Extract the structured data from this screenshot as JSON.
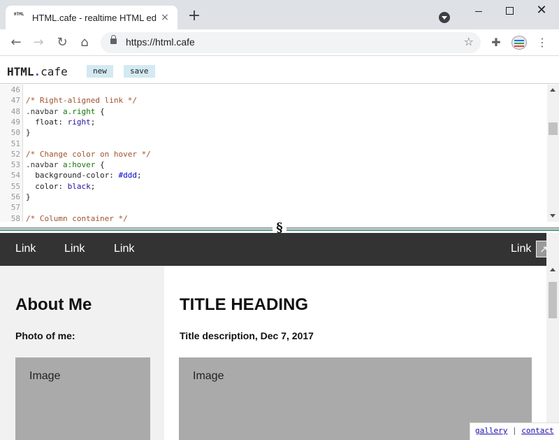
{
  "browser": {
    "tab_title": "HTML.cafe - realtime HTML editor",
    "favicon_text": "HTML",
    "tab_close": "×",
    "new_tab": "+",
    "url": "https://html.cafe",
    "icons": {
      "back": "back-arrow-icon",
      "forward": "forward-arrow-icon",
      "reload": "reload-icon",
      "home": "home-icon",
      "star": "star-icon",
      "extensions": "puzzle-icon",
      "menu": "kebab-menu-icon"
    },
    "glyphs": {
      "back": "←",
      "forward": "→",
      "reload": "↻",
      "home": "⌂",
      "star": "☆",
      "extensions": "✚",
      "menu": "⋮",
      "close": "✕"
    }
  },
  "app": {
    "logo_main": "HTML",
    "logo_dot": ".",
    "logo_suffix": "cafe",
    "buttons": {
      "new": "new",
      "save": "save"
    },
    "splitter_glyph": "§",
    "accent_color": "#7b3fbf"
  },
  "editor": {
    "lines": [
      {
        "num": "46",
        "text": ""
      },
      {
        "num": "47",
        "text": "/* Right-aligned link */"
      },
      {
        "num": "48",
        "text": ".navbar a.right {"
      },
      {
        "num": "49",
        "text": "  float: right;"
      },
      {
        "num": "50",
        "text": "}"
      },
      {
        "num": "51",
        "text": ""
      },
      {
        "num": "52",
        "text": "/* Change color on hover */"
      },
      {
        "num": "53",
        "text": ".navbar a:hover {"
      },
      {
        "num": "54",
        "text": "  background-color: #ddd;"
      },
      {
        "num": "55",
        "text": "  color: black;"
      },
      {
        "num": "56",
        "text": "}"
      },
      {
        "num": "57",
        "text": ""
      },
      {
        "num": "58",
        "text": "/* Column container */"
      }
    ]
  },
  "preview": {
    "nav": {
      "link1": "Link",
      "link2": "Link",
      "link3": "Link",
      "link_right": "Link",
      "expand_glyph": "↗"
    },
    "side": {
      "heading": "About Me",
      "photo_label": "Photo of me:",
      "image_label": "Image"
    },
    "main": {
      "heading": "TITLE HEADING",
      "description": "Title description, Dec 7, 2017",
      "image_label": "Image"
    },
    "footer": {
      "gallery": "gallery",
      "separator": "|",
      "contact": "contact"
    }
  }
}
